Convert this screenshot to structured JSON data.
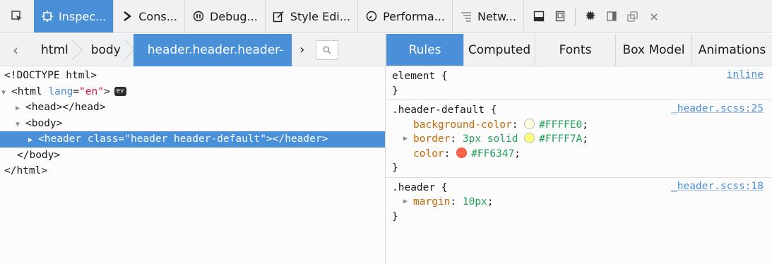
{
  "toolbar": {
    "tabs": [
      {
        "label": "Inspec...",
        "icon": "inspector-icon"
      },
      {
        "label": "Cons...",
        "icon": "console-icon"
      },
      {
        "label": "Debug...",
        "icon": "debugger-icon"
      },
      {
        "label": "Style Edi...",
        "icon": "style-editor-icon"
      },
      {
        "label": "Performa...",
        "icon": "performance-icon"
      },
      {
        "label": "Netw...",
        "icon": "network-icon"
      }
    ],
    "selected_tab": 0
  },
  "breadcrumbs": {
    "items": [
      "html",
      "body",
      "header.header.header-"
    ]
  },
  "markup": {
    "doctype": "<!DOCTYPE html>",
    "html_open_tag": "<html",
    "html_attr_name": "lang",
    "html_attr_value": "\"en\"",
    "html_close_bracket": ">",
    "event_badge": "ev",
    "head": "<head></head>",
    "body_open": "<body>",
    "header_line": "<header class=\"header header-default\"></header>",
    "body_close": "</body>",
    "html_close": "</html>"
  },
  "rule_tabs": [
    "Rules",
    "Computed",
    "Fonts",
    "Box Model",
    "Animations"
  ],
  "rules": {
    "element": {
      "selector": "element {",
      "source": "inline",
      "close": "}"
    },
    "header_default": {
      "selector": ".header-default {",
      "source": "_header.scss:25",
      "decls": [
        {
          "name": "background-color",
          "value": "#FFFFE0",
          "swatch": "#FFFFE0"
        },
        {
          "name": "border",
          "value_prefix": "3px solid ",
          "value": "#FFFF7A",
          "swatch": "#FFFF7A"
        },
        {
          "name": "color",
          "value": "#FF6347",
          "swatch": "#FF6347"
        }
      ],
      "close": "}"
    },
    "header": {
      "selector": ".header {",
      "source": "_header.scss:18",
      "decls": [
        {
          "name": "margin",
          "value": "10px"
        }
      ],
      "close": "}"
    }
  },
  "colors": {
    "accent": "#4a90d9"
  }
}
